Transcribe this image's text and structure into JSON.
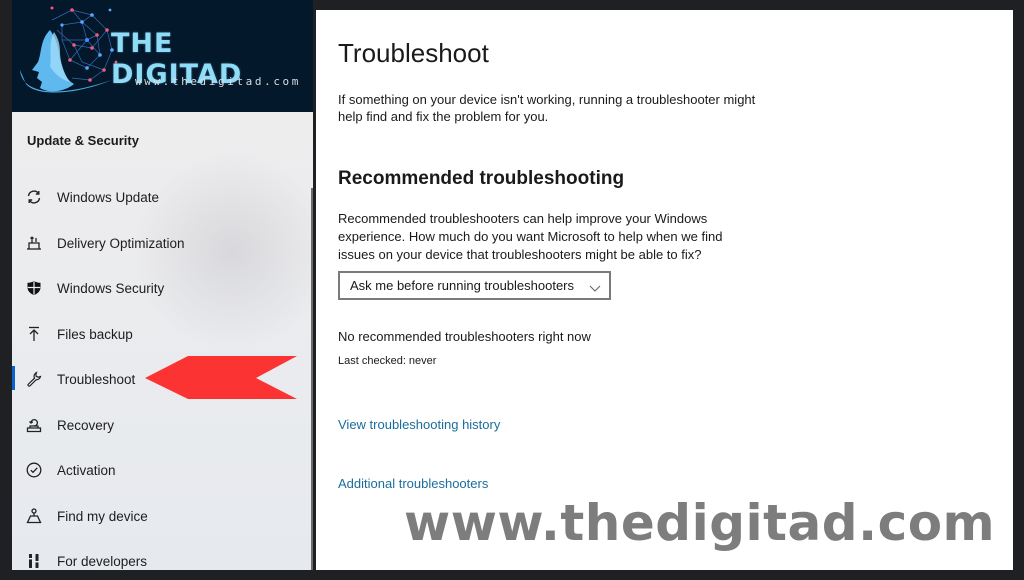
{
  "logo": {
    "title": "THE DIGITAD",
    "url": "www.thedigitad.com"
  },
  "sidebar": {
    "section_title": "Update & Security",
    "selected_index": 4,
    "items": [
      {
        "label": "Windows Update",
        "icon": "sync-icon"
      },
      {
        "label": "Delivery Optimization",
        "icon": "delivery-optimization-icon"
      },
      {
        "label": "Windows Security",
        "icon": "shield-icon"
      },
      {
        "label": "Files backup",
        "icon": "upload-arrow-icon"
      },
      {
        "label": "Troubleshoot",
        "icon": "wrench-icon"
      },
      {
        "label": "Recovery",
        "icon": "recovery-icon"
      },
      {
        "label": "Activation",
        "icon": "check-circle-icon"
      },
      {
        "label": "Find my device",
        "icon": "find-device-icon"
      },
      {
        "label": "For developers",
        "icon": "developer-tools-icon"
      }
    ]
  },
  "annotation": {
    "arrow_color": "#fb3333",
    "points_to": "Troubleshoot"
  },
  "main": {
    "title": "Troubleshoot",
    "description": "If something on your device isn't working, running a troubleshooter might help find and fix the problem for you.",
    "recommended": {
      "heading": "Recommended troubleshooting",
      "description": "Recommended troubleshooters can help improve your Windows experience. How much do you want Microsoft to help when we find issues on your device that troubleshooters might be able to fix?",
      "dropdown_value": "Ask me before running troubleshooters",
      "status": "No recommended troubleshooters right now",
      "last_checked": "Last checked: never"
    },
    "links": {
      "history": "View troubleshooting history",
      "additional": "Additional troubleshooters"
    }
  },
  "watermark": "www.thedigitad.com",
  "colors": {
    "accent": "#0a64c8",
    "link": "#1b6e9b",
    "logo_bg": "#04182b",
    "logo_text": "#8fdcf8"
  }
}
